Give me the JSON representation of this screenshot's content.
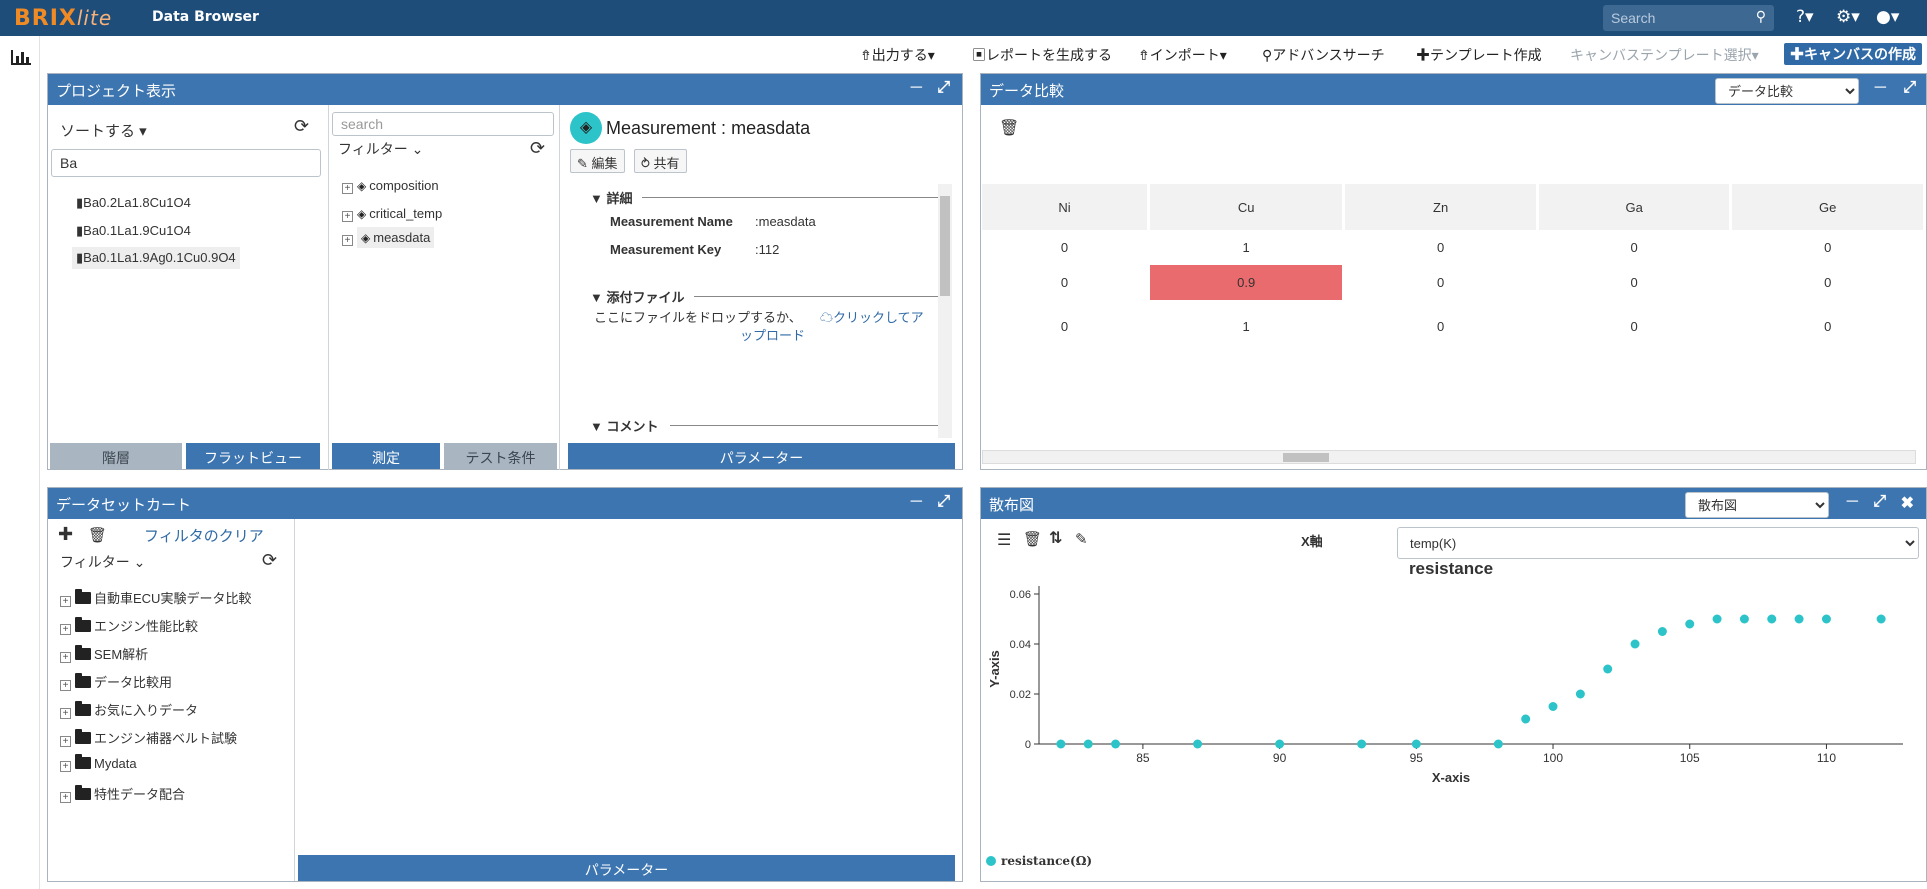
{
  "app": {
    "logo_brand": "BRIX",
    "logo_suffix": "lite",
    "title": "Data Browser"
  },
  "topbar": {
    "search_placeholder": "Search"
  },
  "toolbar": {
    "export": "出力する",
    "report": "レポートを生成する",
    "import": "インポート",
    "advanced_search": "アドバンスサーチ",
    "template_create": "テンプレート作成",
    "canvas_template_select": "キャンバステンプレート選択",
    "canvas_create": "キャンバスの作成"
  },
  "project_panel": {
    "title": "プロジェクト表示",
    "sort_label": "ソートする",
    "filter_value": "Ba",
    "items": [
      "Ba0.2La1.8Cu1O4",
      "Ba0.1La1.9Cu1O4",
      "Ba0.1La1.9Ag0.1Cu0.9O4"
    ],
    "search_placeholder": "search",
    "filter_label": "フィルター",
    "tree": [
      "composition",
      "critical_temp",
      "measdata"
    ],
    "measurement_label": "Measurement :",
    "measurement_name": "measdata",
    "edit_label": "編集",
    "share_label": "共有",
    "details_heading": "詳細",
    "fields": [
      {
        "key": "Measurement Name",
        "value": ":measdata"
      },
      {
        "key": "Measurement Key",
        "value": ":112"
      }
    ],
    "attachments_heading": "添付ファイル",
    "drop_text": "ここにファイルをドロップするか、",
    "upload_link": "クリックしてア",
    "upload_link_2": "ップロード",
    "comment_heading": "コメント",
    "tabs_left": [
      "階層",
      "フラットビュー"
    ],
    "tabs_mid": [
      "測定",
      "テスト条件"
    ],
    "tab_right": "パラメーター"
  },
  "compare_panel": {
    "title": "データ比較",
    "select_value": "データ比較",
    "columns": [
      "Ni",
      "Cu",
      "Zn",
      "Ga",
      "Ge"
    ],
    "rows": [
      [
        "0",
        "1",
        "0",
        "0",
        "0"
      ],
      [
        "0",
        "0.9",
        "0",
        "0",
        "0"
      ],
      [
        "0",
        "1",
        "0",
        "0",
        "0"
      ]
    ]
  },
  "cart_panel": {
    "title": "データセットカート",
    "clear_filter": "フィルタのクリア",
    "filter_label": "フィルター",
    "folders": [
      "自動車ECU実験データ比較",
      "エンジン性能比較",
      "SEM解析",
      "データ比較用",
      "お気に入りデータ",
      "エンジン補器ベルト試験",
      "Mydata",
      "特性データ配合"
    ],
    "bottom_tab": "パラメーター"
  },
  "scatter_panel": {
    "title": "散布図",
    "select_value": "散布図",
    "x_axis_label": "X軸",
    "x_axis_value": "temp(K)"
  },
  "chart_data": {
    "type": "scatter",
    "title": "resistance",
    "xlabel": "X-axis",
    "ylabel": "Y-axis",
    "xlim": [
      81.2,
      112.8
    ],
    "ylim": [
      0,
      0.06
    ],
    "xticks": [
      "85",
      "90",
      "95",
      "100",
      "105",
      "110"
    ],
    "yticks": [
      "0",
      "0.02",
      "0.04",
      "0.06"
    ],
    "legend_position": "bottom-left",
    "color": "#2cc4c9",
    "series": [
      {
        "name": "resistance(Ω)",
        "points": [
          [
            82,
            0
          ],
          [
            83,
            0
          ],
          [
            84,
            0
          ],
          [
            87,
            0
          ],
          [
            90,
            0
          ],
          [
            93,
            0
          ],
          [
            95,
            0
          ],
          [
            98,
            0
          ],
          [
            99,
            0.01
          ],
          [
            100,
            0.015
          ],
          [
            101,
            0.02
          ],
          [
            102,
            0.03
          ],
          [
            103,
            0.04
          ],
          [
            104,
            0.045
          ],
          [
            105,
            0.048
          ],
          [
            106,
            0.05
          ],
          [
            107,
            0.05
          ],
          [
            108,
            0.05
          ],
          [
            109,
            0.05
          ],
          [
            110,
            0.05
          ],
          [
            112,
            0.05
          ]
        ]
      }
    ]
  }
}
